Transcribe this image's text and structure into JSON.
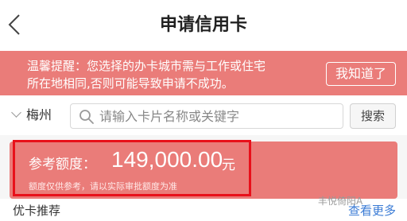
{
  "header": {
    "title": "申请信用卡",
    "back_icon": "chevron-left-icon"
  },
  "notice": {
    "line1": "温馨提醒：您选择的办卡城市需与工作或住宅",
    "line2": "所在地相同,否则可能导致申请不成功。",
    "dismiss_label": "我知道了",
    "background": "#ea7c79"
  },
  "search": {
    "city": "梅州",
    "placeholder": "请输入卡片名称或关键字",
    "button_label": "搜索",
    "icon": "search-icon"
  },
  "quota": {
    "label": "参考额度：",
    "value": "149,000.00",
    "unit": "元",
    "note": "额度仅供参考，请以实际审批额度为准",
    "highlight_color": "#e8101a"
  },
  "recommend": {
    "title": "优卡推荐",
    "more_label": "查看更多"
  },
  "watermark": {
    "text": "丰悦倚阳A"
  }
}
